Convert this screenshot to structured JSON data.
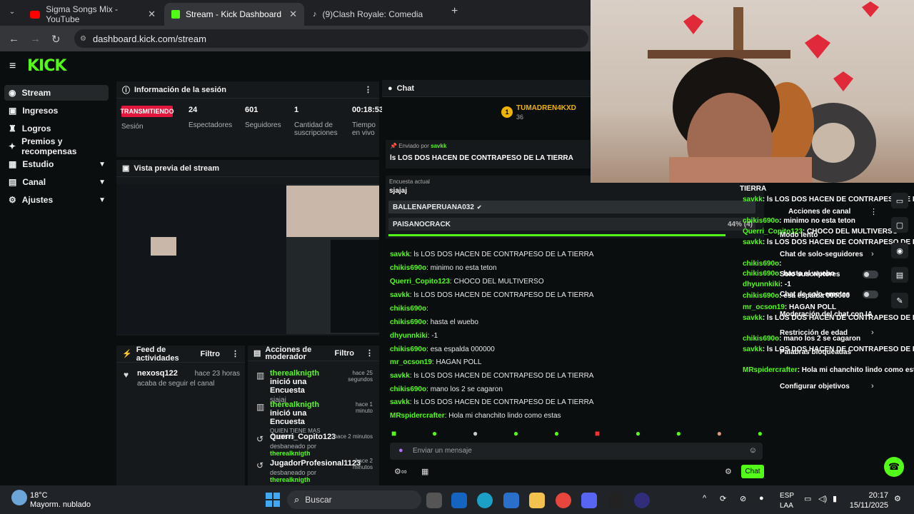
{
  "browser": {
    "tabs": [
      {
        "label": "Sigma Songs Mix - YouTube",
        "active": false
      },
      {
        "label": "Stream - Kick Dashboard",
        "active": true
      },
      {
        "label": "(9)Clash Royale: Comedia Famil",
        "active": false
      }
    ],
    "url": "dashboard.kick.com/stream"
  },
  "brand": {
    "logo": "KICK",
    "accent": "#53fc18"
  },
  "sidebar": {
    "items": [
      {
        "label": "Stream",
        "icon": "broadcast-icon",
        "selected": true
      },
      {
        "label": "Ingresos",
        "icon": "wallet-icon"
      },
      {
        "label": "Logros",
        "icon": "trophy-icon"
      },
      {
        "label": "Premios y recompensas",
        "icon": "gift-icon"
      },
      {
        "label": "Estudio",
        "icon": "studio-icon"
      },
      {
        "label": "Canal",
        "icon": "channel-icon"
      },
      {
        "label": "Ajustes",
        "icon": "gear-icon"
      }
    ]
  },
  "session": {
    "title": "Información de la sesión",
    "live_badge": "TRANSMITIENDO",
    "session_label": "Sesión",
    "stats": [
      {
        "value": "24",
        "label": "Espectadores"
      },
      {
        "value": "601",
        "label": "Seguidores"
      },
      {
        "value": "1",
        "label": "Cantidad de suscripciones"
      },
      {
        "value": "00:18:53",
        "label": "Tiempo en vivo"
      }
    ]
  },
  "preview": {
    "title": "Vista previa del stream"
  },
  "activity": {
    "title": "Feed de actividades",
    "filter": "Filtro",
    "items": [
      {
        "name": "nexosq122",
        "time": "hace 23 horas",
        "detail": "acaba de seguir el canal"
      }
    ]
  },
  "modactions": {
    "title": "Acciones de moderador",
    "filter": "Filtro",
    "items": [
      {
        "who": "therealknigth",
        "action": "inició una Encuesta",
        "time": "hace 25 segundos",
        "detail": "sjajaj"
      },
      {
        "who": "therealknigth",
        "action": "inició una Encuesta",
        "time": "hace 1 minuto",
        "detail": "QUIEN TIENE MAS CUERPO"
      },
      {
        "who": "Querri_Copito123",
        "action": "",
        "time": "hace 2 minutos",
        "detail": "desbaneado por",
        "by": "therealknigth"
      },
      {
        "who": "JugadorProfesional1123",
        "action": "",
        "time": "hace 2 minutos",
        "detail": "desbaneado por",
        "by": "therealknigth"
      }
    ]
  },
  "chat": {
    "title": "Chat",
    "top_user": "TUMADREN4KXD",
    "top_count": "36",
    "pinned_by_label": "Enviado por",
    "pinned_by": "savkk",
    "pinned_text": "ls LOS DOS HACEN DE CONTRAPESO DE LA TIERRA",
    "poll_label": "Encuesta actual",
    "poll_question": "sjajaj",
    "poll_options": [
      {
        "label": "BALLENAPERUANA032",
        "share": 0.56
      },
      {
        "label": "PAISANOCRACK",
        "share": 0.44,
        "text": "44% (4)"
      }
    ],
    "messages": [
      {
        "user": "savkk",
        "text": ": ls LOS DOS HACEN DE CONTRAPESO DE LA TIERRA"
      },
      {
        "user": "chikis690o",
        "text": ": minimo no esta teton"
      },
      {
        "user": "Querri_Copito123",
        "text": ": CHOCO DEL MULTIVERSO"
      },
      {
        "user": "savkk",
        "text": ": ls LOS DOS HACEN DE CONTRAPESO DE LA TIERRA"
      },
      {
        "user": "chikis690o",
        "text": ":"
      },
      {
        "user": "chikis690o",
        "text": ": hasta el wuebo"
      },
      {
        "user": "dhyunnkiki",
        "text": ": -1"
      },
      {
        "user": "chikis690o",
        "text": ": esa espalda 000000"
      },
      {
        "user": "mr_ocson19",
        "text": ": HAGAN POLL"
      },
      {
        "user": "savkk",
        "text": ": ls LOS DOS HACEN DE CONTRAPESO DE LA TIERRA"
      },
      {
        "user": "chikis690o",
        "text": ": mano los 2 se cagaron"
      },
      {
        "user": "savkk",
        "text": ": ls LOS DOS HACEN DE CONTRAPESO DE LA TIERRA"
      },
      {
        "user": "MRspidercrafter",
        "text": ": Hola mi chanchito lindo como estas"
      }
    ],
    "input_placeholder": "Enviar un mensaje",
    "send_label": "Chat"
  },
  "overlay": {
    "tierra": "TIERRA",
    "channel_actions": "Acciones de canal",
    "settings": [
      {
        "label": "Modo lento"
      },
      {
        "label": "Chat de solo-seguidores"
      },
      {
        "label": "Solo suscriptores",
        "toggle": false
      },
      {
        "label": "Chat de solo-emotes",
        "toggle": false
      },
      {
        "label": "Moderación del chat con IA"
      },
      {
        "label": "Restricción de edad"
      },
      {
        "label": "Palabras bloqueadas"
      },
      {
        "label": "Configurar objetivos"
      }
    ],
    "messages": [
      {
        "user": "savkk",
        "text": ": ls LOS DOS HACEN DE CONTRAPESO DE LA"
      },
      {
        "user": "chikis690o",
        "text": ": minimo no esta teton"
      },
      {
        "user": "Querri_Copito123",
        "text": ": CHOCO DEL MULTIVERSO"
      },
      {
        "user": "savkk",
        "text": ": ls LOS DOS HACEN DE CONTRAPESO DE LA"
      },
      {
        "user": "chikis690o",
        "text": ":"
      },
      {
        "user": "chikis690o",
        "text": ": hasta el wuebo"
      },
      {
        "user": "dhyunnkiki",
        "text": ": -1"
      },
      {
        "user": "chikis690o",
        "text": ": esa espalda 000000"
      },
      {
        "user": "mr_ocson19",
        "text": ": HAGAN POLL"
      },
      {
        "user": "savkk",
        "text": ": ls LOS DOS HACEN DE CONTRAPESO DE LA"
      },
      {
        "user": "chikis690o",
        "text": ": mano los 2 se cagaron"
      },
      {
        "user": "savkk",
        "text": ": ls LOS DOS HACEN DE CONTRAPESO DE LA"
      },
      {
        "user": "MRspidercrafter",
        "text": ": Hola mi chanchito lindo como estas"
      }
    ]
  },
  "taskbar": {
    "weather_temp": "18°C",
    "weather_desc": "Mayorm. nublado",
    "search": "Buscar",
    "lang_top": "ESP",
    "lang_bottom": "LAA",
    "time": "20:17",
    "date": "15/11/2025"
  }
}
